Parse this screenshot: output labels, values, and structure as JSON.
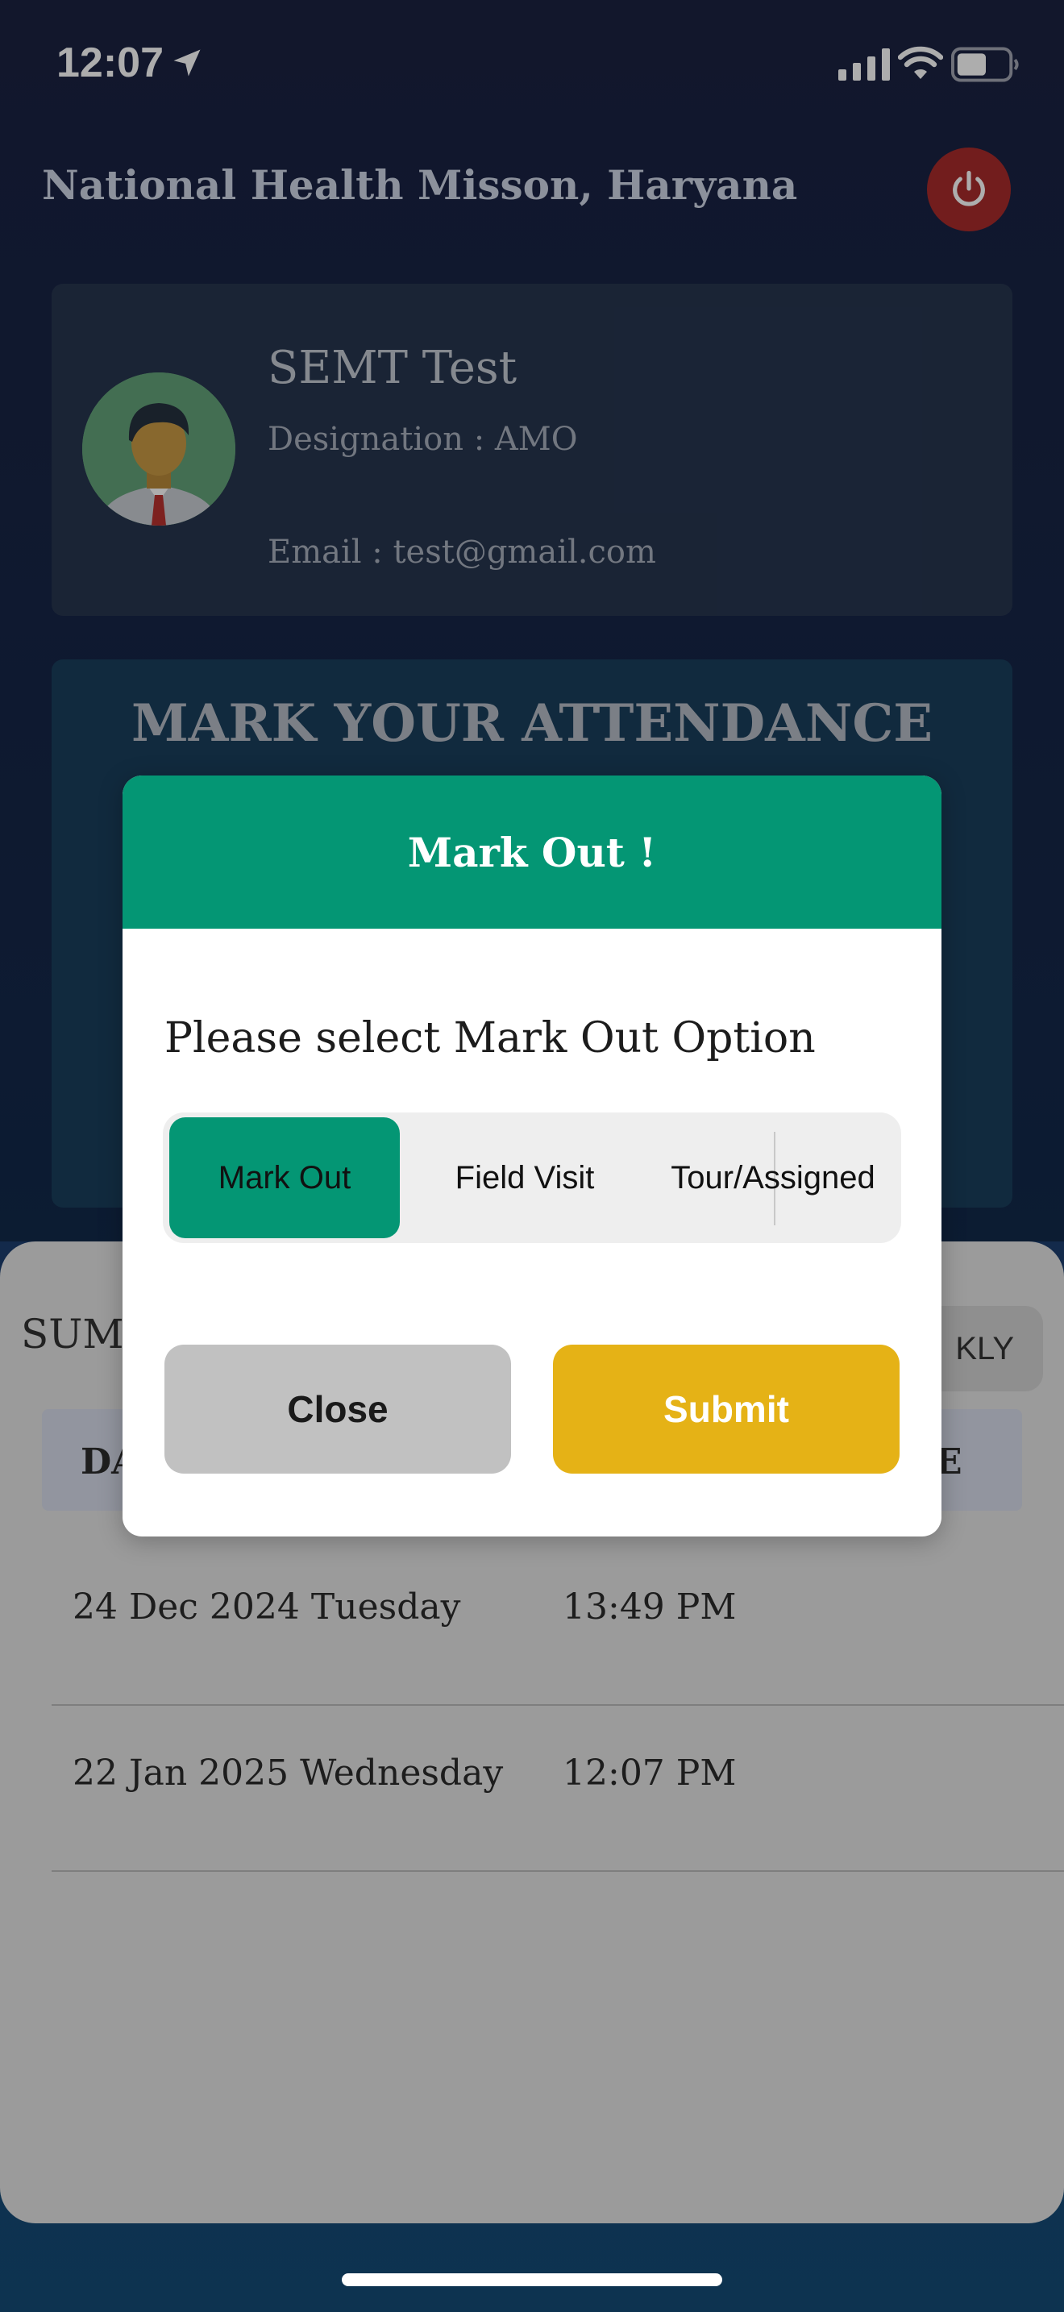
{
  "status_bar": {
    "time": "12:07"
  },
  "header": {
    "title": "National Health Misson, Haryana"
  },
  "profile": {
    "name": "SEMT Test",
    "designation": "Designation : AMO",
    "email": "Email : test@gmail.com"
  },
  "attendance": {
    "title": "MARK YOUR ATTENDANCE"
  },
  "summary": {
    "label": "SUMM",
    "weekly_label": "KLY",
    "columns": [
      "DA",
      "E"
    ],
    "rows": [
      {
        "date": "24 Dec 2024 Tuesday",
        "time": "13:49 PM"
      },
      {
        "date": "22 Jan 2025 Wednesday",
        "time": "12:07 PM"
      }
    ]
  },
  "modal": {
    "title": "Mark Out !",
    "prompt": "Please select Mark Out Option",
    "options": [
      "Mark Out",
      "Field Visit",
      "Tour/Assigned"
    ],
    "selected_option": "Mark Out",
    "close_label": "Close",
    "submit_label": "Submit"
  },
  "colors": {
    "accent_green": "#049674",
    "submit_yellow": "#e5b216",
    "logout_red": "#a92b2b"
  }
}
